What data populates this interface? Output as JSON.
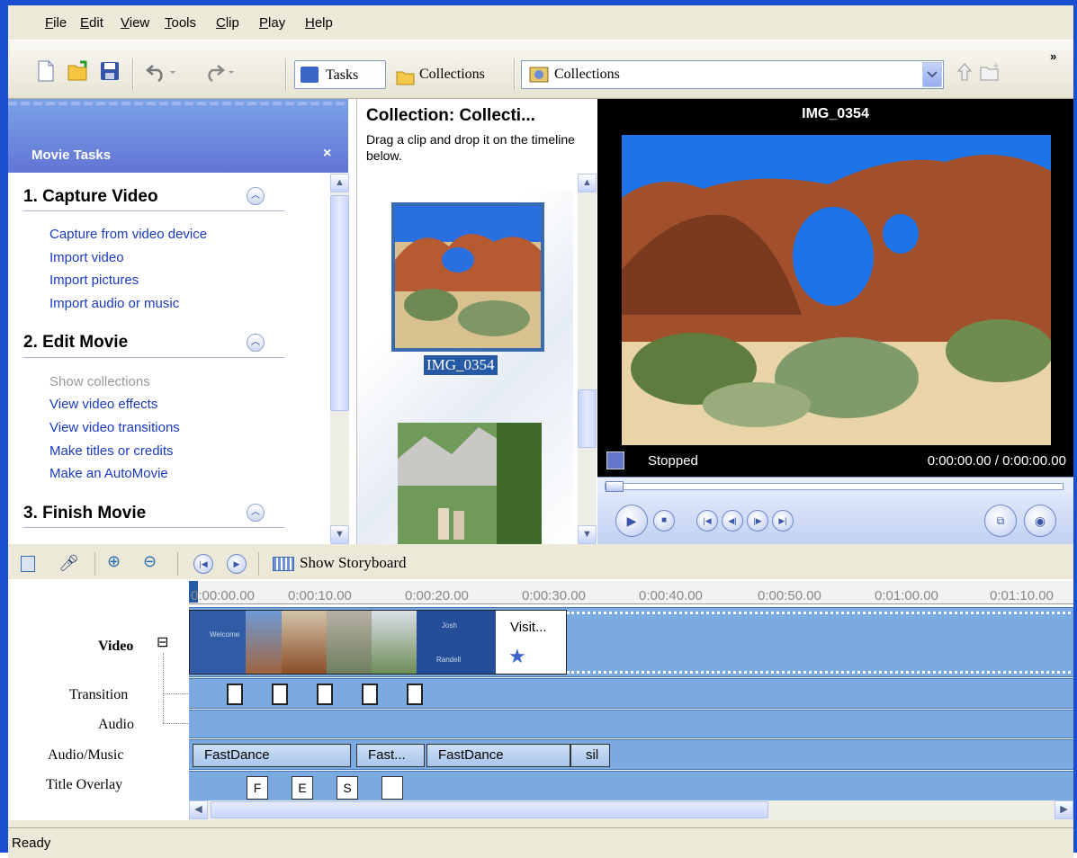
{
  "menu": {
    "items": [
      "File",
      "Edit",
      "View",
      "Tools",
      "Clip",
      "Play",
      "Help"
    ],
    "keys": [
      "F",
      "E",
      "V",
      "T",
      "C",
      "P",
      "H"
    ]
  },
  "toolbar": {
    "tasks": "Tasks",
    "collections": "Collections",
    "combo_value": "Collections",
    "more": "»"
  },
  "tasks_pane": {
    "title": "Movie Tasks",
    "close": "×",
    "sections": [
      {
        "title": "1. Capture Video",
        "items": [
          "Capture from video device",
          "Import video",
          "Import pictures",
          "Import audio or music"
        ]
      },
      {
        "title": "2. Edit Movie",
        "items": [
          "Show collections",
          "View video effects",
          "View video transitions",
          "Make titles or credits",
          "Make an AutoMovie"
        ]
      },
      {
        "title": "3. Finish Movie",
        "items": []
      }
    ]
  },
  "collection": {
    "title": "Collection: Collecti...",
    "description": "Drag a clip and drop it on the timeline below.",
    "selected_clip": "IMG_0354"
  },
  "preview": {
    "title": "IMG_0354",
    "status": "Stopped",
    "time": "0:00:00.00 / 0:00:00.00"
  },
  "timeline": {
    "show_storyboard": "Show Storyboard",
    "ticks": [
      "0:00:00.00",
      "0:00:10.00",
      "0:00:20.00",
      "0:00:30.00",
      "0:00:40.00",
      "0:00:50.00",
      "0:01:00.00",
      "0:01:10.00"
    ],
    "tracks": {
      "video": "Video",
      "video_toggle": "⊟",
      "transition": "Transition",
      "audio": "Audio",
      "audio_music": "Audio/Music",
      "title_overlay": "Title Overlay"
    },
    "audio_clips": [
      "FastDance",
      "Fast...",
      "FastDance",
      "sil"
    ],
    "overlay_clips": [
      "F",
      "E",
      "S",
      ""
    ],
    "end_clip": "Visit...",
    "credit_text": [
      "Josh",
      "Randell"
    ],
    "video_welcome": "Welcome"
  },
  "statusbar": {
    "text": "Ready"
  },
  "colors": {
    "accent": "#1a4fd0",
    "link": "#1a3ac1",
    "selection": "#2659a6",
    "track": "#7aaae0"
  }
}
